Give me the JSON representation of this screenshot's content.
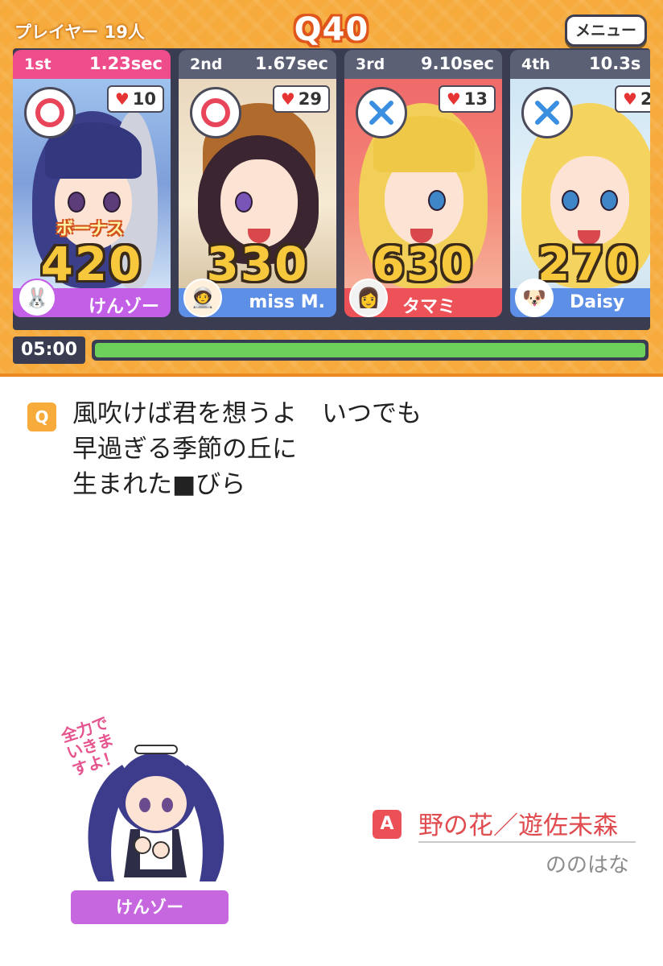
{
  "header": {
    "players": "プレイヤー 19人",
    "question_number": "Q40",
    "menu_label": "メニュー"
  },
  "cards": [
    {
      "rank": "1st",
      "time": "1.23sec",
      "likes": "10",
      "mark": "correct",
      "bonus": "ボーナス",
      "score": "420",
      "name": "けんゾー",
      "name_color": "#c35fe6",
      "avatar_icon": "rabbit-icon"
    },
    {
      "rank": "2nd",
      "time": "1.67sec",
      "likes": "29",
      "mark": "correct",
      "bonus": "",
      "score": "330",
      "name": "miss M.",
      "name_color": "#5d8fe6",
      "avatar_icon": "astronaut-icon"
    },
    {
      "rank": "3rd",
      "time": "9.10sec",
      "likes": "13",
      "mark": "wrong",
      "bonus": "",
      "score": "630",
      "name": "タマミ",
      "name_color": "#ec5257",
      "avatar_icon": "portrait-icon"
    },
    {
      "rank": "4th",
      "time": "10.3s",
      "likes": "2",
      "mark": "wrong",
      "bonus": "",
      "score": "270",
      "name": "Daisy",
      "name_color": "#5d8fe6",
      "avatar_icon": "dog-icon"
    }
  ],
  "timer": {
    "text": "05:00",
    "progress": 1.0,
    "color": "#6cd05a"
  },
  "question": {
    "badge": "Q",
    "text": "風吹けば君を想うよ　いつでも\n早過ぎる季節の丘に\n生まれた■びら"
  },
  "sticker": {
    "speech": "全力でいきますよ！",
    "label": "けんゾー"
  },
  "answer": {
    "badge": "A",
    "text": "野の花／遊佐未森",
    "reading": "ののはな"
  }
}
